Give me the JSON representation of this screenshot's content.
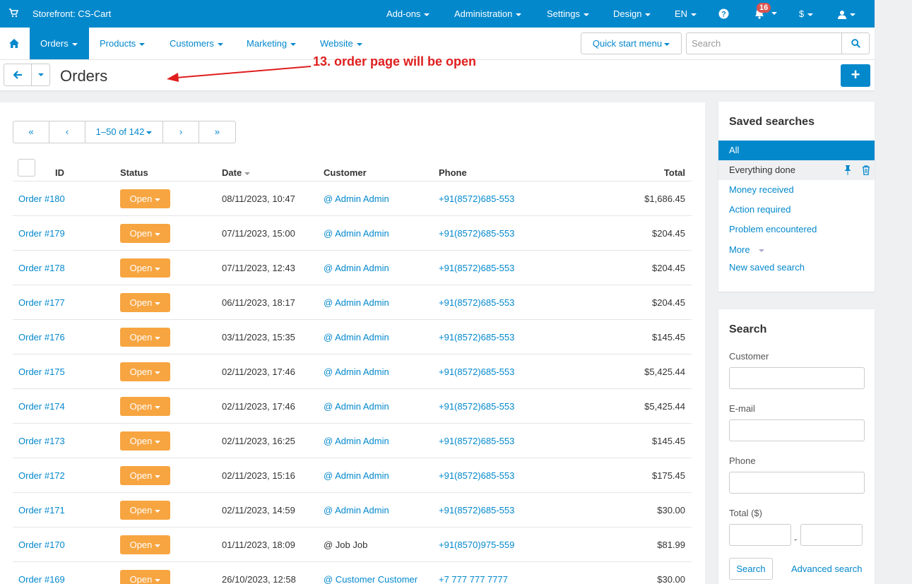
{
  "topbar": {
    "store": "Storefront: CS-Cart",
    "nav": [
      "Add-ons",
      "Administration",
      "Settings",
      "Design",
      "EN"
    ],
    "notifications_count": "16",
    "currency": "$",
    "icons": [
      "cart-icon",
      "help-icon",
      "bell-icon",
      "user-icon"
    ]
  },
  "navbar": {
    "items": [
      "Orders",
      "Products",
      "Customers",
      "Marketing",
      "Website"
    ],
    "quick_start": "Quick start menu",
    "search_placeholder": "Search"
  },
  "titlebar": {
    "title": "Orders",
    "annotation": "13. order page will be open"
  },
  "pager": {
    "range": "1–50 of 142",
    "first": "«",
    "prev": "‹",
    "next": "›",
    "last": "»"
  },
  "table": {
    "headers": {
      "id": "ID",
      "status": "Status",
      "date": "Date",
      "customer": "Customer",
      "phone": "Phone",
      "total": "Total"
    },
    "rows": [
      {
        "id": "Order #180",
        "status": "Open",
        "date": "08/11/2023, 10:47",
        "customer": "@ Admin Admin",
        "phone": "+91(8572)685-553",
        "total": "$1,686.45"
      },
      {
        "id": "Order #179",
        "status": "Open",
        "date": "07/11/2023, 15:00",
        "customer": "@ Admin Admin",
        "phone": "+91(8572)685-553",
        "total": "$204.45"
      },
      {
        "id": "Order #178",
        "status": "Open",
        "date": "07/11/2023, 12:43",
        "customer": "@ Admin Admin",
        "phone": "+91(8572)685-553",
        "total": "$204.45"
      },
      {
        "id": "Order #177",
        "status": "Open",
        "date": "06/11/2023, 18:17",
        "customer": "@ Admin Admin",
        "phone": "+91(8572)685-553",
        "total": "$204.45"
      },
      {
        "id": "Order #176",
        "status": "Open",
        "date": "03/11/2023, 15:35",
        "customer": "@ Admin Admin",
        "phone": "+91(8572)685-553",
        "total": "$145.45"
      },
      {
        "id": "Order #175",
        "status": "Open",
        "date": "02/11/2023, 17:46",
        "customer": "@ Admin Admin",
        "phone": "+91(8572)685-553",
        "total": "$5,425.44"
      },
      {
        "id": "Order #174",
        "status": "Open",
        "date": "02/11/2023, 17:46",
        "customer": "@ Admin Admin",
        "phone": "+91(8572)685-553",
        "total": "$5,425.44"
      },
      {
        "id": "Order #173",
        "status": "Open",
        "date": "02/11/2023, 16:25",
        "customer": "@ Admin Admin",
        "phone": "+91(8572)685-553",
        "total": "$145.45"
      },
      {
        "id": "Order #172",
        "status": "Open",
        "date": "02/11/2023, 15:16",
        "customer": "@ Admin Admin",
        "phone": "+91(8572)685-553",
        "total": "$175.45"
      },
      {
        "id": "Order #171",
        "status": "Open",
        "date": "02/11/2023, 14:59",
        "customer": "@ Admin Admin",
        "phone": "+91(8572)685-553",
        "total": "$30.00"
      },
      {
        "id": "Order #170",
        "status": "Open",
        "date": "01/11/2023, 18:09",
        "customer": "@ Job Job",
        "customer_plain": true,
        "phone": "+91(8570)975-559",
        "total": "$81.99"
      },
      {
        "id": "Order #169",
        "status": "Open",
        "date": "26/10/2023, 12:58",
        "customer": "@ Customer Customer",
        "phone": "+7 777 777 7777",
        "total": "$30.00"
      }
    ]
  },
  "saved_searches": {
    "title": "Saved searches",
    "items": [
      "All",
      "Everything done",
      "Money received",
      "Action required",
      "Problem encountered",
      "More",
      "New saved search"
    ]
  },
  "search_panel": {
    "title": "Search",
    "customer_label": "Customer",
    "email_label": "E-mail",
    "phone_label": "Phone",
    "total_label": "Total ($)",
    "range_sep": "-",
    "search_button": "Search",
    "advanced_link": "Advanced search"
  },
  "colors": {
    "primary": "#0388cc",
    "status_open": "#f7a541",
    "annotation": "#e01e1e"
  }
}
